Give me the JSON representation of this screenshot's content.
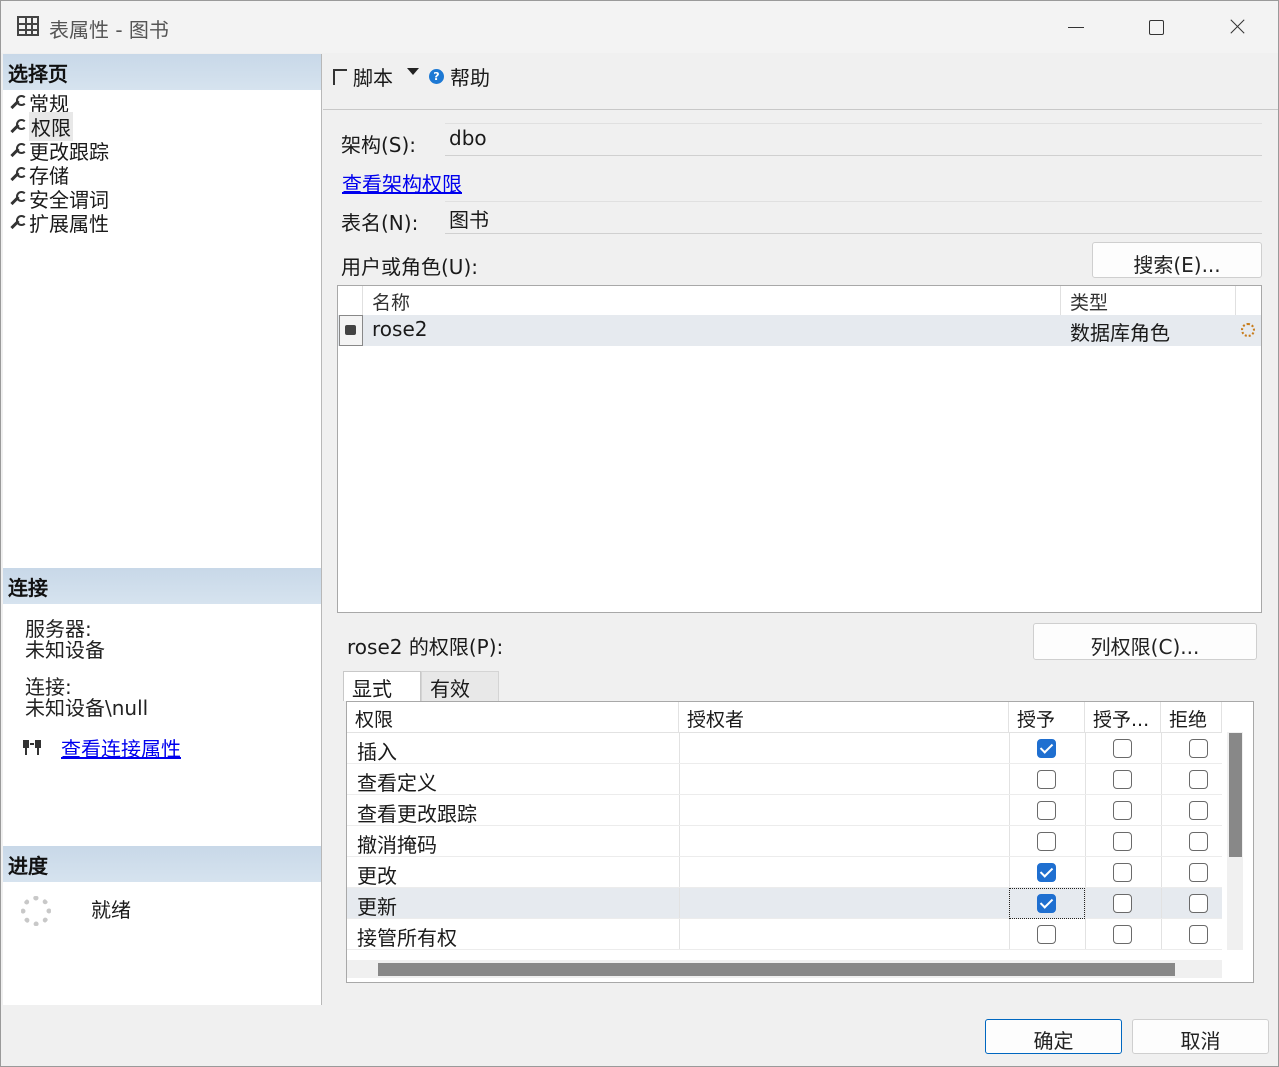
{
  "window": {
    "title": "表属性 - 图书",
    "icon": "table-icon",
    "controls": [
      "minimize-icon",
      "maximize-icon",
      "close-icon"
    ]
  },
  "left": {
    "select_page_header": "选择页",
    "nav_items": [
      {
        "label": "常规"
      },
      {
        "label": "权限",
        "selected": true
      },
      {
        "label": "更改跟踪"
      },
      {
        "label": "存储"
      },
      {
        "label": "安全谓词"
      },
      {
        "label": "扩展属性"
      }
    ],
    "connection_header": "连接",
    "server_label": "服务器:",
    "server_value": "未知设备",
    "connection_label": "连接:",
    "connection_value": "未知设备\\null",
    "view_connection_link": "查看连接属性",
    "progress_header": "进度",
    "progress_status": "就绪"
  },
  "toolbar": {
    "script_label": "脚本",
    "help_label": "帮助"
  },
  "form": {
    "schema_label": "架构(S):",
    "schema_value": "dbo",
    "view_schema_link": "查看架构权限",
    "table_name_label": "表名(N):",
    "table_name_value": "图书",
    "users_label": "用户或角色(U):",
    "search_button": "搜索(E)...",
    "users_columns": [
      "名称",
      "类型"
    ],
    "users": [
      {
        "name": "rose2",
        "type": "数据库角色"
      }
    ],
    "permissions_label": "rose2 的权限(P):",
    "column_perms_button": "列权限(C)...",
    "tabs": [
      "显式",
      "有效"
    ],
    "perm_columns": [
      "权限",
      "授权者",
      "授予",
      "授予...",
      "拒绝"
    ],
    "permissions": [
      {
        "name": "插入",
        "grant": true,
        "with_grant": false,
        "deny": false
      },
      {
        "name": "查看定义",
        "grant": false,
        "with_grant": false,
        "deny": false
      },
      {
        "name": "查看更改跟踪",
        "grant": false,
        "with_grant": false,
        "deny": false
      },
      {
        "name": "撤消掩码",
        "grant": false,
        "with_grant": false,
        "deny": false
      },
      {
        "name": "更改",
        "grant": true,
        "with_grant": false,
        "deny": false
      },
      {
        "name": "更新",
        "grant": true,
        "with_grant": false,
        "deny": false,
        "selected": true
      },
      {
        "name": "接管所有权",
        "grant": false,
        "with_grant": false,
        "deny": false
      }
    ]
  },
  "footer": {
    "ok_button": "确定",
    "cancel_button": "取消"
  },
  "colors": {
    "section_header": "#c8d8e8",
    "checkbox_checked": "#1f6fd0",
    "link": "#0000ee",
    "selected_row": "#e6eaef"
  }
}
